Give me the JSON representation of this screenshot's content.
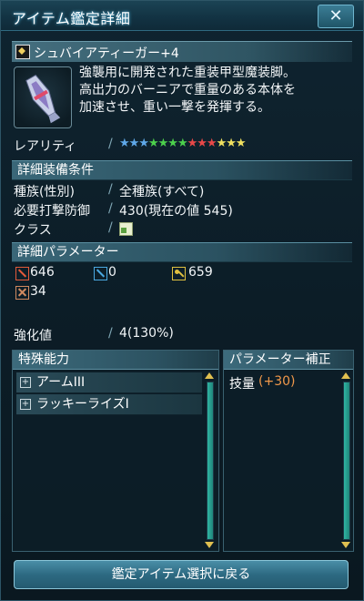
{
  "window": {
    "title": "アイテム鑑定詳細",
    "close_label": "✕"
  },
  "item": {
    "name": "シュバイアティーガー+4",
    "description_lines": [
      "強襲用に開発された重装甲型魔装脚。",
      "高出力のバーニアで重量のある本体を",
      "加速させ、重い一撃を発揮する。"
    ]
  },
  "rarity": {
    "label": "レアリティ",
    "star_count": 13,
    "star_colors": [
      "#5fa8e8",
      "#5fa8e8",
      "#5fa8e8",
      "#4cd04c",
      "#4cd04c",
      "#4cd04c",
      "#4cd04c",
      "#e84848",
      "#e84848",
      "#e84848",
      "#f0e060",
      "#f0e060",
      "#f0e060"
    ]
  },
  "equip_conditions": {
    "header": "詳細装備条件",
    "rows": [
      {
        "label": "種族(性別)",
        "value": "全種族(すべて)"
      },
      {
        "label": "必要打撃防御",
        "value": "430(現在の値 545)"
      },
      {
        "label": "クラス",
        "value": ""
      }
    ]
  },
  "parameters": {
    "header": "詳細パラメーター",
    "stats": [
      {
        "icon": "striking-attack-icon",
        "value": "646",
        "color": "#e25a3a"
      },
      {
        "icon": "ranged-attack-icon",
        "value": "0",
        "color": "#4aa8e0"
      },
      {
        "icon": "technique-attack-icon",
        "value": "659",
        "color": "#e0c040"
      },
      {
        "icon": "dexterity-icon",
        "value": "34",
        "color": "#d08a60"
      }
    ]
  },
  "grind": {
    "label": "強化値",
    "value": "4(130%)"
  },
  "special_abilities": {
    "header": "特殊能力",
    "items": [
      "アームIII",
      "ラッキーライズI"
    ]
  },
  "param_bonus": {
    "header": "パラメーター補正",
    "label": "技量",
    "value": "(+30)"
  },
  "bottom_button": {
    "label": "鑑定アイテム選択に戻る"
  },
  "separator": "/"
}
